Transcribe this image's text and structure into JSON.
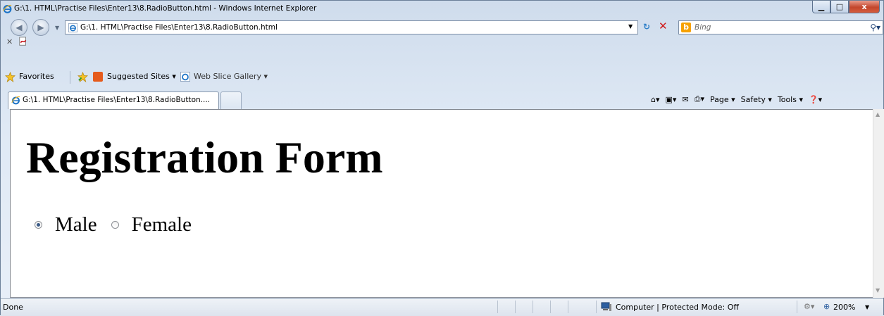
{
  "window": {
    "title": "G:\\1. HTML\\Practise Files\\Enter13\\8.RadioButton.html - Windows Internet Explorer",
    "close_label": "x"
  },
  "address_bar": {
    "url": "G:\\1. HTML\\Practise Files\\Enter13\\8.RadioButton.html"
  },
  "search": {
    "placeholder": "Bing"
  },
  "favorites_bar": {
    "favorites_label": "Favorites",
    "suggested_sites_label": "Suggested Sites ▾",
    "web_slice_gallery_label": "Web Slice Gallery ▾"
  },
  "tab": {
    "label": "G:\\1. HTML\\Practise Files\\Enter13\\8.RadioButton...."
  },
  "command_bar": {
    "page_label": "Page ▾",
    "safety_label": "Safety ▾",
    "tools_label": "Tools ▾"
  },
  "page": {
    "heading": "Registration Form",
    "radios": [
      {
        "label": "Male",
        "checked": true
      },
      {
        "label": "Female",
        "checked": false
      }
    ]
  },
  "status_bar": {
    "status": "Done",
    "zone": "Computer | Protected Mode: Off",
    "zoom": "200%"
  },
  "colors": {
    "window_frame": "#cfdcec",
    "close_button": "#c3462c",
    "bing_accent": "#f6a100"
  }
}
